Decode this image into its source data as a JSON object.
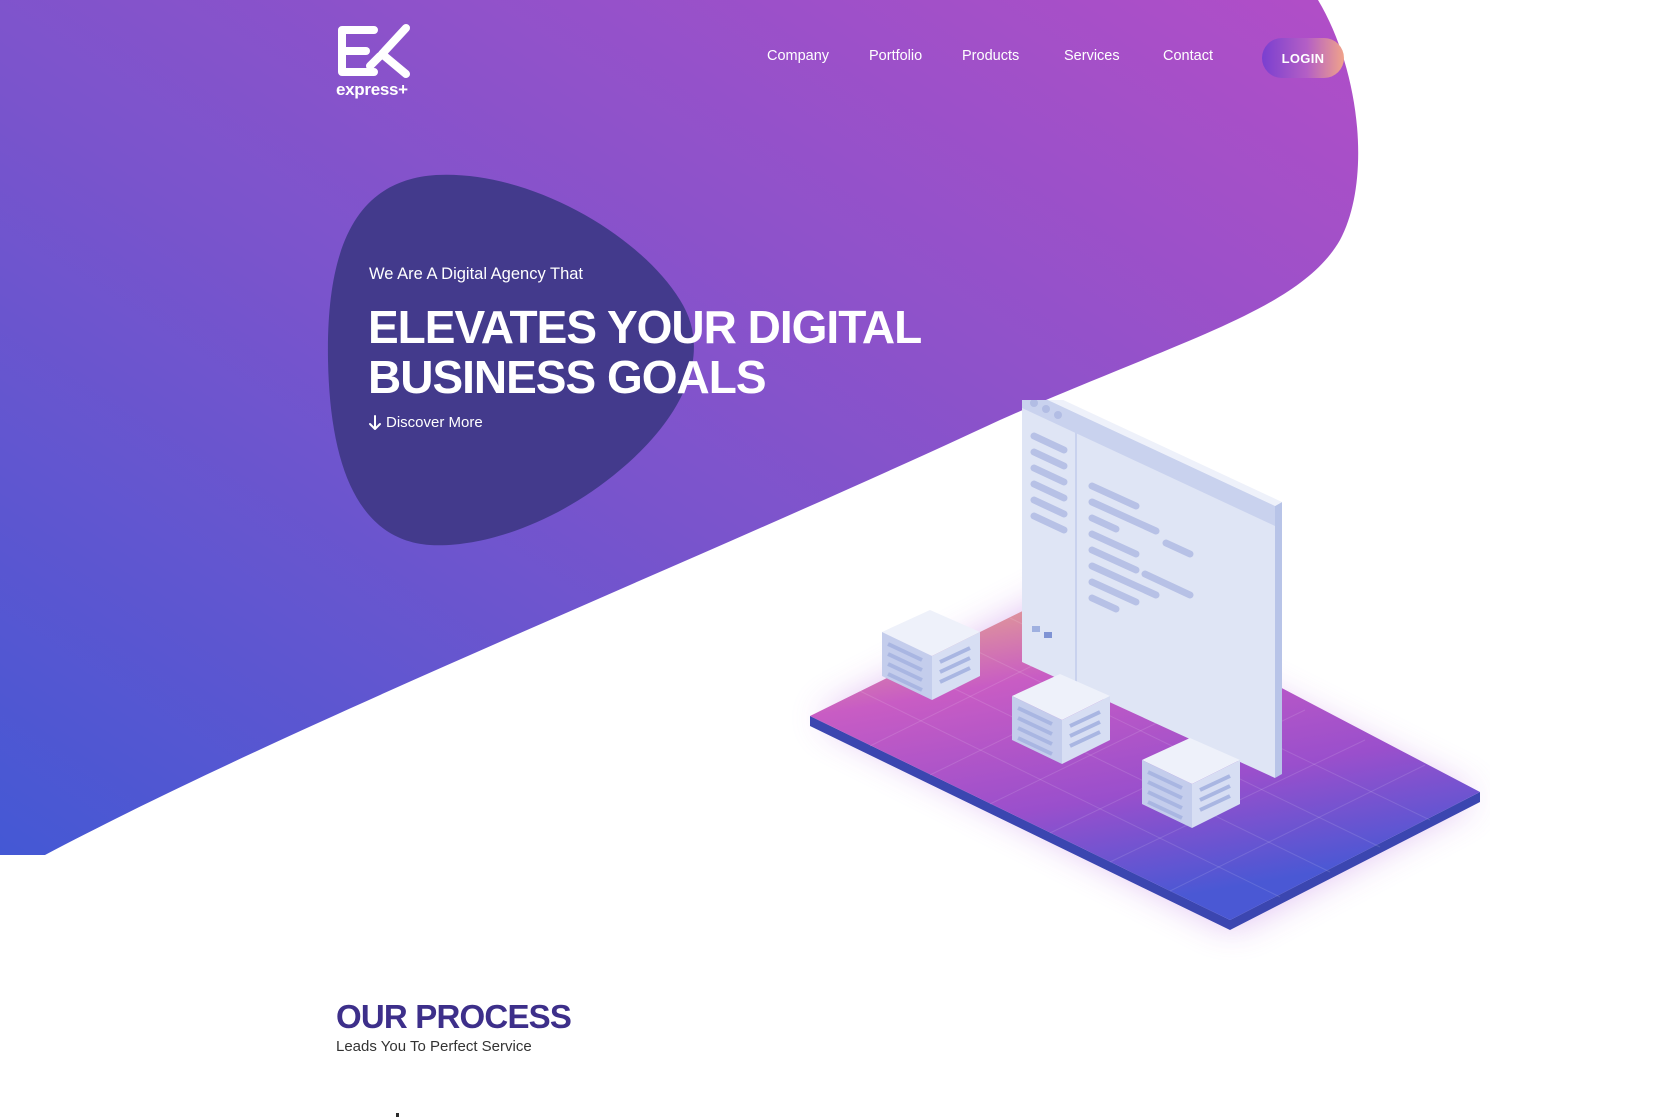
{
  "brand": {
    "logo_text": "express+"
  },
  "nav": {
    "items": [
      {
        "label": "Company"
      },
      {
        "label": "Portfolio"
      },
      {
        "label": "Products"
      },
      {
        "label": "Services"
      },
      {
        "label": "Contact"
      }
    ],
    "login_label": "LOGIN"
  },
  "hero": {
    "tagline": "We Are A Digital Agency That",
    "headline_line1": "ELEVATES YOUR DIGITAL",
    "headline_line2": "BUSINESS GOALS",
    "discover_label": "Discover More"
  },
  "process": {
    "title": "OUR PROCESS",
    "subtitle": "Leads You To Perfect Service"
  },
  "colors": {
    "gradient_start": "#4a5ad6",
    "gradient_mid": "#8a55cc",
    "gradient_end": "#b04fc8",
    "blob": "#433a8c",
    "accent_title": "#3d2f8a"
  }
}
